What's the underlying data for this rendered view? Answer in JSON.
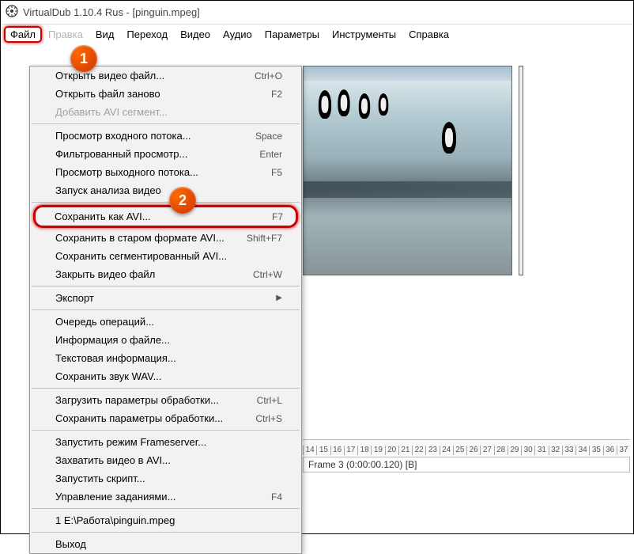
{
  "window": {
    "title": "VirtualDub 1.10.4 Rus - [pinguin.mpeg]"
  },
  "menubar": {
    "items": [
      "Файл",
      "Правка",
      "Вид",
      "Переход",
      "Видео",
      "Аудио",
      "Параметры",
      "Инструменты",
      "Справка"
    ]
  },
  "badges": {
    "one": "1",
    "two": "2"
  },
  "menu": {
    "open_video": {
      "label": "Открыть видео файл...",
      "shortcut": "Ctrl+O"
    },
    "reopen": {
      "label": "Открыть файл заново",
      "shortcut": "F2"
    },
    "add_avi": {
      "label": "Добавить AVI сегмент..."
    },
    "preview_in": {
      "label": "Просмотр входного потока...",
      "shortcut": "Space"
    },
    "preview_filtered": {
      "label": "Фильтрованный просмотр...",
      "shortcut": "Enter"
    },
    "preview_out": {
      "label": "Просмотр выходного потока...",
      "shortcut": "F5"
    },
    "run_analysis": {
      "label": "Запуск анализа видео"
    },
    "save_avi": {
      "label": "Сохранить как AVI...",
      "shortcut": "F7"
    },
    "save_old_avi": {
      "label": "Сохранить в старом формате AVI...",
      "shortcut": "Shift+F7"
    },
    "save_seg_avi": {
      "label": "Сохранить сегментированный AVI..."
    },
    "close_video": {
      "label": "Закрыть видео файл",
      "shortcut": "Ctrl+W"
    },
    "export": {
      "label": "Экспорт"
    },
    "queue": {
      "label": "Очередь операций..."
    },
    "file_info": {
      "label": "Информация о файле..."
    },
    "text_info": {
      "label": "Текстовая информация..."
    },
    "save_wav": {
      "label": "Сохранить звук WAV..."
    },
    "load_proc": {
      "label": "Загрузить параметры обработки...",
      "shortcut": "Ctrl+L"
    },
    "save_proc": {
      "label": "Сохранить параметры обработки...",
      "shortcut": "Ctrl+S"
    },
    "start_fs": {
      "label": "Запустить режим Frameserver..."
    },
    "capture_avi": {
      "label": "Захватить видео в AVI..."
    },
    "run_script": {
      "label": "Запустить скрипт..."
    },
    "job_ctrl": {
      "label": "Управление заданиями...",
      "shortcut": "F4"
    },
    "recent1": {
      "label": "1 E:\\Работа\\pinguin.mpeg"
    },
    "exit": {
      "label": "Выход"
    }
  },
  "ruler": {
    "ticks": [
      "14",
      "15",
      "16",
      "17",
      "18",
      "19",
      "20",
      "21",
      "22",
      "23",
      "24",
      "25",
      "26",
      "27",
      "28",
      "29",
      "30",
      "31",
      "32",
      "33",
      "34",
      "35",
      "36",
      "37"
    ]
  },
  "status": {
    "text": "Frame 3 (0:00:00.120) [B]"
  }
}
